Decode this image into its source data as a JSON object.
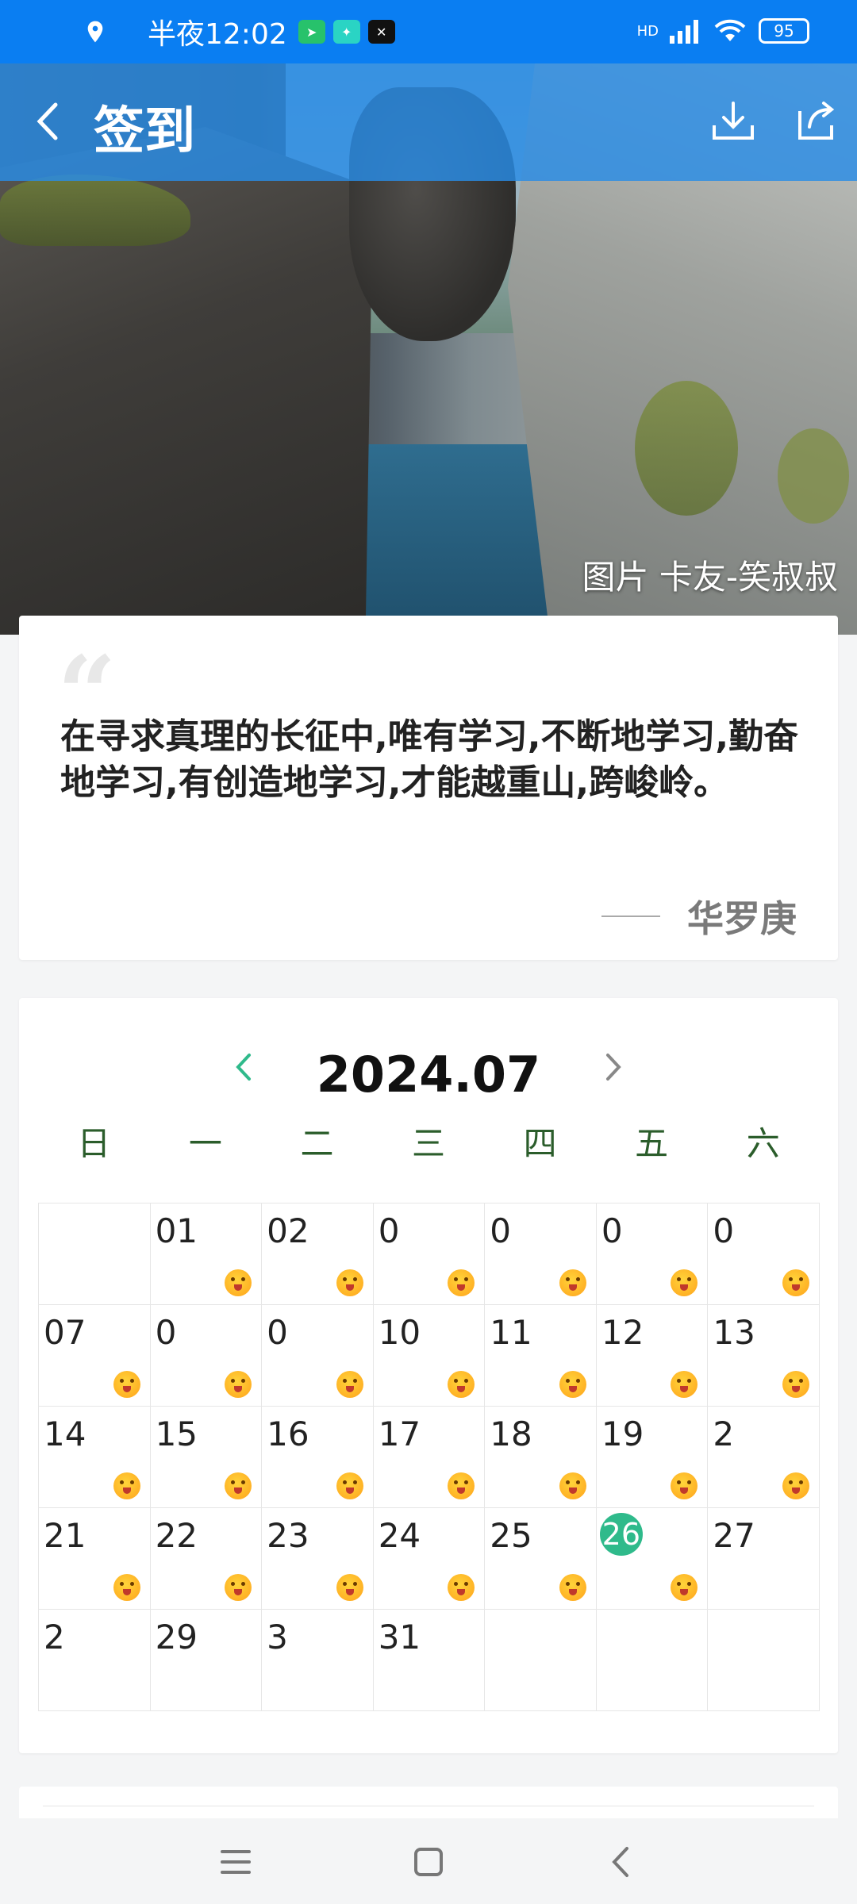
{
  "status_bar": {
    "time": "半夜12:02",
    "battery": "95",
    "network": "HD",
    "mini_icons": [
      "send-icon",
      "app-icon",
      "capcut-icon"
    ]
  },
  "header": {
    "title": "签到",
    "back_icon": "chevron-left-icon",
    "download_icon": "download-icon",
    "share_icon": "share-icon"
  },
  "hero": {
    "credit": "图片 卡友-笑叔叔"
  },
  "quote": {
    "text": "在寻求真理的长征中,唯有学习,不断地学习,勤奋地学习,有创造地学习,才能越重山,跨峻岭。",
    "author": "华罗庚"
  },
  "calendar": {
    "month": "2024.07",
    "weekdays": [
      "日",
      "一",
      "二",
      "三",
      "四",
      "五",
      "六"
    ],
    "cells": [
      {
        "num": "",
        "emoji": false,
        "today": false
      },
      {
        "num": "01",
        "emoji": true,
        "today": false
      },
      {
        "num": "02",
        "emoji": true,
        "today": false
      },
      {
        "num": "0",
        "emoji": true,
        "today": false
      },
      {
        "num": "0",
        "emoji": true,
        "today": false
      },
      {
        "num": "0",
        "emoji": true,
        "today": false
      },
      {
        "num": "0",
        "emoji": true,
        "today": false
      },
      {
        "num": "07",
        "emoji": true,
        "today": false
      },
      {
        "num": "0",
        "emoji": true,
        "today": false
      },
      {
        "num": "0",
        "emoji": true,
        "today": false
      },
      {
        "num": "10",
        "emoji": true,
        "today": false
      },
      {
        "num": "11",
        "emoji": true,
        "today": false
      },
      {
        "num": "12",
        "emoji": true,
        "today": false
      },
      {
        "num": "13",
        "emoji": true,
        "today": false
      },
      {
        "num": "14",
        "emoji": true,
        "today": false
      },
      {
        "num": "15",
        "emoji": true,
        "today": false
      },
      {
        "num": "16",
        "emoji": true,
        "today": false
      },
      {
        "num": "17",
        "emoji": true,
        "today": false
      },
      {
        "num": "18",
        "emoji": true,
        "today": false
      },
      {
        "num": "19",
        "emoji": true,
        "today": false
      },
      {
        "num": "2",
        "emoji": true,
        "today": false
      },
      {
        "num": "21",
        "emoji": true,
        "today": false
      },
      {
        "num": "22",
        "emoji": true,
        "today": false
      },
      {
        "num": "23",
        "emoji": true,
        "today": false
      },
      {
        "num": "24",
        "emoji": true,
        "today": false
      },
      {
        "num": "25",
        "emoji": true,
        "today": false
      },
      {
        "num": "26",
        "emoji": true,
        "today": true
      },
      {
        "num": "27",
        "emoji": false,
        "today": false
      },
      {
        "num": "2",
        "emoji": false,
        "today": false
      },
      {
        "num": "29",
        "emoji": false,
        "today": false
      },
      {
        "num": "3",
        "emoji": false,
        "today": false
      },
      {
        "num": "31",
        "emoji": false,
        "today": false
      },
      {
        "num": "",
        "emoji": false,
        "today": false
      },
      {
        "num": "",
        "emoji": false,
        "today": false
      },
      {
        "num": "",
        "emoji": false,
        "today": false
      }
    ]
  },
  "colors": {
    "status_bar": "#0a7ef2",
    "header": "#2a8ce6",
    "today_badge": "#2fba8b",
    "weekday": "#2b5d2b",
    "nav_arrow": "#2fba8b"
  },
  "nav": {
    "menu_icon": "menu-icon",
    "home_icon": "home-icon",
    "back_icon": "back-icon"
  }
}
